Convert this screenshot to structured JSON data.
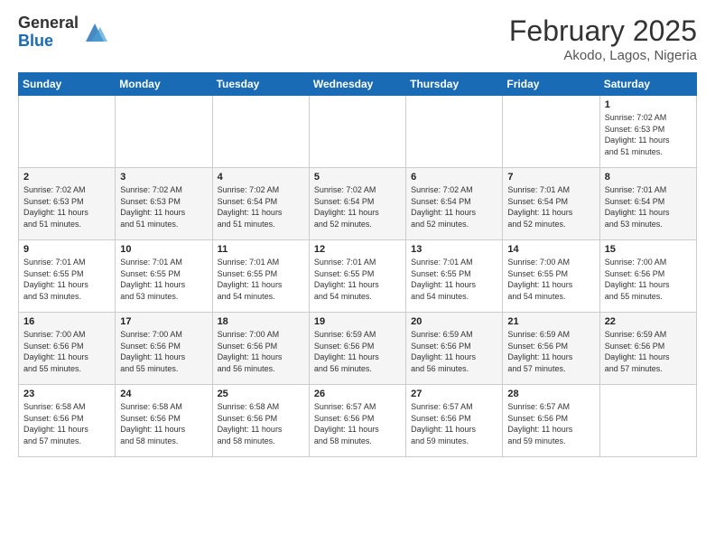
{
  "header": {
    "logo_general": "General",
    "logo_blue": "Blue",
    "title": "February 2025",
    "subtitle": "Akodo, Lagos, Nigeria"
  },
  "weekdays": [
    "Sunday",
    "Monday",
    "Tuesday",
    "Wednesday",
    "Thursday",
    "Friday",
    "Saturday"
  ],
  "weeks": [
    [
      {
        "date": "",
        "info": ""
      },
      {
        "date": "",
        "info": ""
      },
      {
        "date": "",
        "info": ""
      },
      {
        "date": "",
        "info": ""
      },
      {
        "date": "",
        "info": ""
      },
      {
        "date": "",
        "info": ""
      },
      {
        "date": "1",
        "info": "Sunrise: 7:02 AM\nSunset: 6:53 PM\nDaylight: 11 hours\nand 51 minutes."
      }
    ],
    [
      {
        "date": "2",
        "info": "Sunrise: 7:02 AM\nSunset: 6:53 PM\nDaylight: 11 hours\nand 51 minutes."
      },
      {
        "date": "3",
        "info": "Sunrise: 7:02 AM\nSunset: 6:53 PM\nDaylight: 11 hours\nand 51 minutes."
      },
      {
        "date": "4",
        "info": "Sunrise: 7:02 AM\nSunset: 6:54 PM\nDaylight: 11 hours\nand 51 minutes."
      },
      {
        "date": "5",
        "info": "Sunrise: 7:02 AM\nSunset: 6:54 PM\nDaylight: 11 hours\nand 52 minutes."
      },
      {
        "date": "6",
        "info": "Sunrise: 7:02 AM\nSunset: 6:54 PM\nDaylight: 11 hours\nand 52 minutes."
      },
      {
        "date": "7",
        "info": "Sunrise: 7:01 AM\nSunset: 6:54 PM\nDaylight: 11 hours\nand 52 minutes."
      },
      {
        "date": "8",
        "info": "Sunrise: 7:01 AM\nSunset: 6:54 PM\nDaylight: 11 hours\nand 53 minutes."
      }
    ],
    [
      {
        "date": "9",
        "info": "Sunrise: 7:01 AM\nSunset: 6:55 PM\nDaylight: 11 hours\nand 53 minutes."
      },
      {
        "date": "10",
        "info": "Sunrise: 7:01 AM\nSunset: 6:55 PM\nDaylight: 11 hours\nand 53 minutes."
      },
      {
        "date": "11",
        "info": "Sunrise: 7:01 AM\nSunset: 6:55 PM\nDaylight: 11 hours\nand 54 minutes."
      },
      {
        "date": "12",
        "info": "Sunrise: 7:01 AM\nSunset: 6:55 PM\nDaylight: 11 hours\nand 54 minutes."
      },
      {
        "date": "13",
        "info": "Sunrise: 7:01 AM\nSunset: 6:55 PM\nDaylight: 11 hours\nand 54 minutes."
      },
      {
        "date": "14",
        "info": "Sunrise: 7:00 AM\nSunset: 6:55 PM\nDaylight: 11 hours\nand 54 minutes."
      },
      {
        "date": "15",
        "info": "Sunrise: 7:00 AM\nSunset: 6:56 PM\nDaylight: 11 hours\nand 55 minutes."
      }
    ],
    [
      {
        "date": "16",
        "info": "Sunrise: 7:00 AM\nSunset: 6:56 PM\nDaylight: 11 hours\nand 55 minutes."
      },
      {
        "date": "17",
        "info": "Sunrise: 7:00 AM\nSunset: 6:56 PM\nDaylight: 11 hours\nand 55 minutes."
      },
      {
        "date": "18",
        "info": "Sunrise: 7:00 AM\nSunset: 6:56 PM\nDaylight: 11 hours\nand 56 minutes."
      },
      {
        "date": "19",
        "info": "Sunrise: 6:59 AM\nSunset: 6:56 PM\nDaylight: 11 hours\nand 56 minutes."
      },
      {
        "date": "20",
        "info": "Sunrise: 6:59 AM\nSunset: 6:56 PM\nDaylight: 11 hours\nand 56 minutes."
      },
      {
        "date": "21",
        "info": "Sunrise: 6:59 AM\nSunset: 6:56 PM\nDaylight: 11 hours\nand 57 minutes."
      },
      {
        "date": "22",
        "info": "Sunrise: 6:59 AM\nSunset: 6:56 PM\nDaylight: 11 hours\nand 57 minutes."
      }
    ],
    [
      {
        "date": "23",
        "info": "Sunrise: 6:58 AM\nSunset: 6:56 PM\nDaylight: 11 hours\nand 57 minutes."
      },
      {
        "date": "24",
        "info": "Sunrise: 6:58 AM\nSunset: 6:56 PM\nDaylight: 11 hours\nand 58 minutes."
      },
      {
        "date": "25",
        "info": "Sunrise: 6:58 AM\nSunset: 6:56 PM\nDaylight: 11 hours\nand 58 minutes."
      },
      {
        "date": "26",
        "info": "Sunrise: 6:57 AM\nSunset: 6:56 PM\nDaylight: 11 hours\nand 58 minutes."
      },
      {
        "date": "27",
        "info": "Sunrise: 6:57 AM\nSunset: 6:56 PM\nDaylight: 11 hours\nand 59 minutes."
      },
      {
        "date": "28",
        "info": "Sunrise: 6:57 AM\nSunset: 6:56 PM\nDaylight: 11 hours\nand 59 minutes."
      },
      {
        "date": "",
        "info": ""
      }
    ]
  ]
}
